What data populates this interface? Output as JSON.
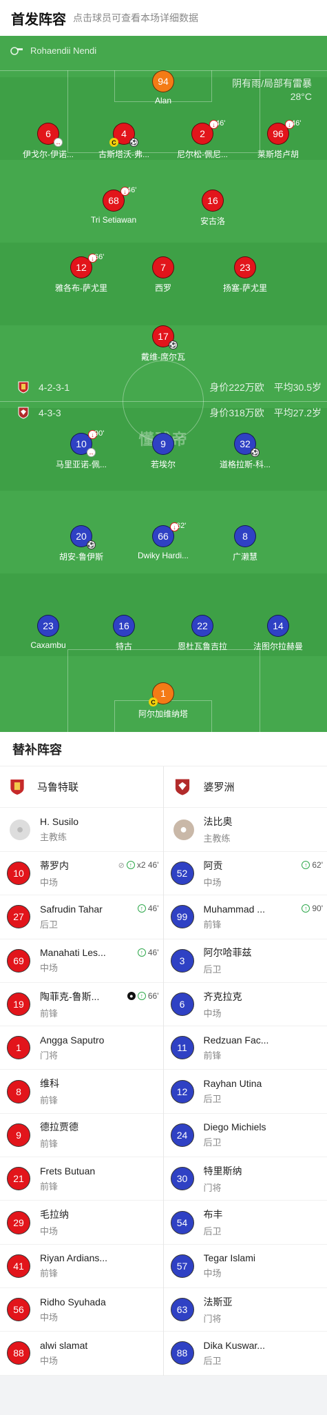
{
  "header": {
    "title": "首发阵容",
    "subtitle": "点击球员可查看本场详细数据"
  },
  "referee": {
    "name": "Rohaendii Nendi",
    "icon": "whistle-icon"
  },
  "weather": {
    "condition": "阴有雨/局部有雷暴",
    "temperature": "28°C"
  },
  "home": {
    "formation": "4-2-3-1",
    "value": "身价222万欧",
    "avg_age": "平均30.5岁",
    "color": "#e2151b",
    "players": [
      {
        "number": "94",
        "name": "Alan",
        "color": "orange"
      },
      {
        "number": "6",
        "name": "伊戈尔-伊诺..."
      },
      {
        "number": "4",
        "name": "古斯塔沃-弗..."
      },
      {
        "number": "2",
        "name": "尼尔松-佩尼...",
        "sub": "46'"
      },
      {
        "number": "96",
        "name": "莱斯塔卢胡",
        "sub": "46'"
      },
      {
        "number": "68",
        "name": "Tri Setiawan",
        "sub": "46'"
      },
      {
        "number": "16",
        "name": "安古洛"
      },
      {
        "number": "12",
        "name": "雅各布-萨尤里",
        "sub": "66'"
      },
      {
        "number": "7",
        "name": "西罗"
      },
      {
        "number": "23",
        "name": "扬塞-萨尤里"
      },
      {
        "number": "17",
        "name": "戴维-席尔瓦"
      }
    ]
  },
  "away": {
    "formation": "4-3-3",
    "value": "身价318万欧",
    "avg_age": "平均27.2岁",
    "color": "#2f41c4",
    "players": [
      {
        "number": "10",
        "name": "马里亚诺-佩...",
        "sub": "90'"
      },
      {
        "number": "9",
        "name": "若埃尔"
      },
      {
        "number": "32",
        "name": "道格拉斯-科..."
      },
      {
        "number": "20",
        "name": "胡安-鲁伊斯"
      },
      {
        "number": "66",
        "name": "Dwiky Hardi...",
        "sub": "62'"
      },
      {
        "number": "8",
        "name": "广濑慧"
      },
      {
        "number": "23",
        "name": "Caxambu"
      },
      {
        "number": "16",
        "name": "特古"
      },
      {
        "number": "22",
        "name": "恩杜瓦鲁吉拉"
      },
      {
        "number": "14",
        "name": "法图尔拉赫曼"
      },
      {
        "number": "1",
        "name": "阿尔加维纳塔",
        "color": "orange"
      }
    ]
  },
  "watermark": "懂球帝",
  "subs": {
    "title": "替补阵容",
    "home_team": "马鲁特联",
    "away_team": "婆罗洲",
    "home_coach": {
      "name": "H. Susilo",
      "role": "主教练"
    },
    "away_coach": {
      "name": "法比奥",
      "role": "主教练"
    },
    "home": [
      {
        "number": "10",
        "name": "蒂罗内",
        "pos": "中场",
        "events": "x2 46'"
      },
      {
        "number": "27",
        "name": "Safrudin Tahar",
        "pos": "后卫",
        "events": "46'"
      },
      {
        "number": "69",
        "name": "Manahati Les...",
        "pos": "中场",
        "events": "46'"
      },
      {
        "number": "19",
        "name": "陶菲克-鲁斯...",
        "pos": "前锋",
        "events": "66'"
      },
      {
        "number": "1",
        "name": "Angga Saputro",
        "pos": "门将"
      },
      {
        "number": "8",
        "name": "维科",
        "pos": "前锋"
      },
      {
        "number": "9",
        "name": "德拉贾德",
        "pos": "前锋"
      },
      {
        "number": "21",
        "name": "Frets Butuan",
        "pos": "前锋"
      },
      {
        "number": "29",
        "name": "毛拉纳",
        "pos": "中场"
      },
      {
        "number": "41",
        "name": "Riyan Ardians...",
        "pos": "前锋"
      },
      {
        "number": "56",
        "name": "Ridho Syuhada",
        "pos": "中场"
      },
      {
        "number": "88",
        "name": "alwi slamat",
        "pos": "中场"
      }
    ],
    "away": [
      {
        "number": "52",
        "name": "阿贡",
        "pos": "中场",
        "events": "62'"
      },
      {
        "number": "99",
        "name": "Muhammad ...",
        "pos": "前锋",
        "events": "90'"
      },
      {
        "number": "3",
        "name": "阿尔哈菲兹",
        "pos": "后卫"
      },
      {
        "number": "6",
        "name": "齐克拉克",
        "pos": "中场"
      },
      {
        "number": "11",
        "name": "Redzuan Fac...",
        "pos": "前锋"
      },
      {
        "number": "12",
        "name": "Rayhan Utina",
        "pos": "后卫"
      },
      {
        "number": "24",
        "name": "Diego Michiels",
        "pos": "后卫"
      },
      {
        "number": "30",
        "name": "特里斯纳",
        "pos": "门将"
      },
      {
        "number": "54",
        "name": "布丰",
        "pos": "后卫"
      },
      {
        "number": "57",
        "name": "Tegar Islami",
        "pos": "中场"
      },
      {
        "number": "63",
        "name": "法斯亚",
        "pos": "门将"
      },
      {
        "number": "88",
        "name": "Dika Kuswar...",
        "pos": "后卫"
      }
    ]
  }
}
